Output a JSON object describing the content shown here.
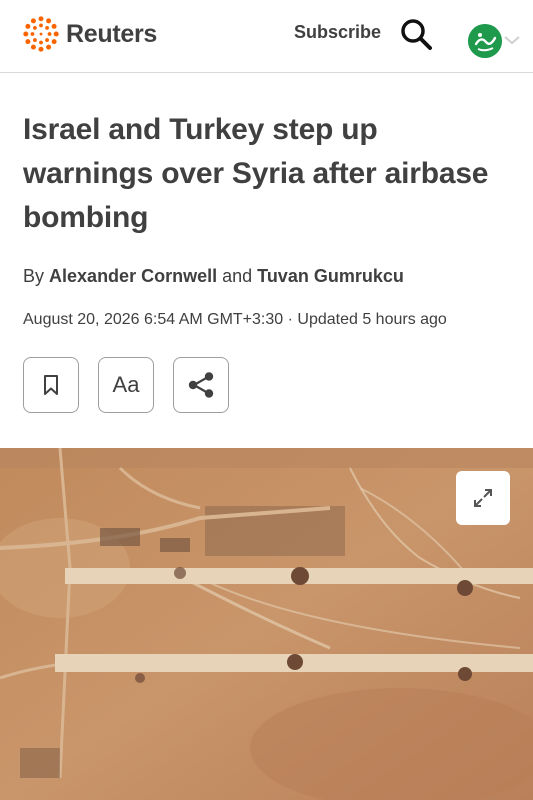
{
  "header": {
    "brand": "Reuters",
    "subscribe_label": "Subscribe",
    "icons": {
      "logo": "reuters-logo-icon",
      "search": "search-icon",
      "avatar": "avatar",
      "chevron": "chevron-down-icon"
    },
    "brand_color": "#fa6400"
  },
  "article": {
    "headline": "Israel and Turkey step up warnings over Syria after airbase bombing",
    "byline": {
      "prefix": "By",
      "author1": "Alexander Cornwell",
      "conjunction": "and",
      "author2": "Tuvan Gumrukcu"
    },
    "dateline": "August 20, 2026 6:54 AM GMT+3:30 · Updated 5 hours ago",
    "actions": {
      "bookmark_icon": "bookmark-icon",
      "text_size_label": "Aa",
      "share_icon": "share-icon"
    },
    "image": {
      "alt_subject": "satellite-image-airbase",
      "expand_icon": "expand-icon"
    }
  }
}
